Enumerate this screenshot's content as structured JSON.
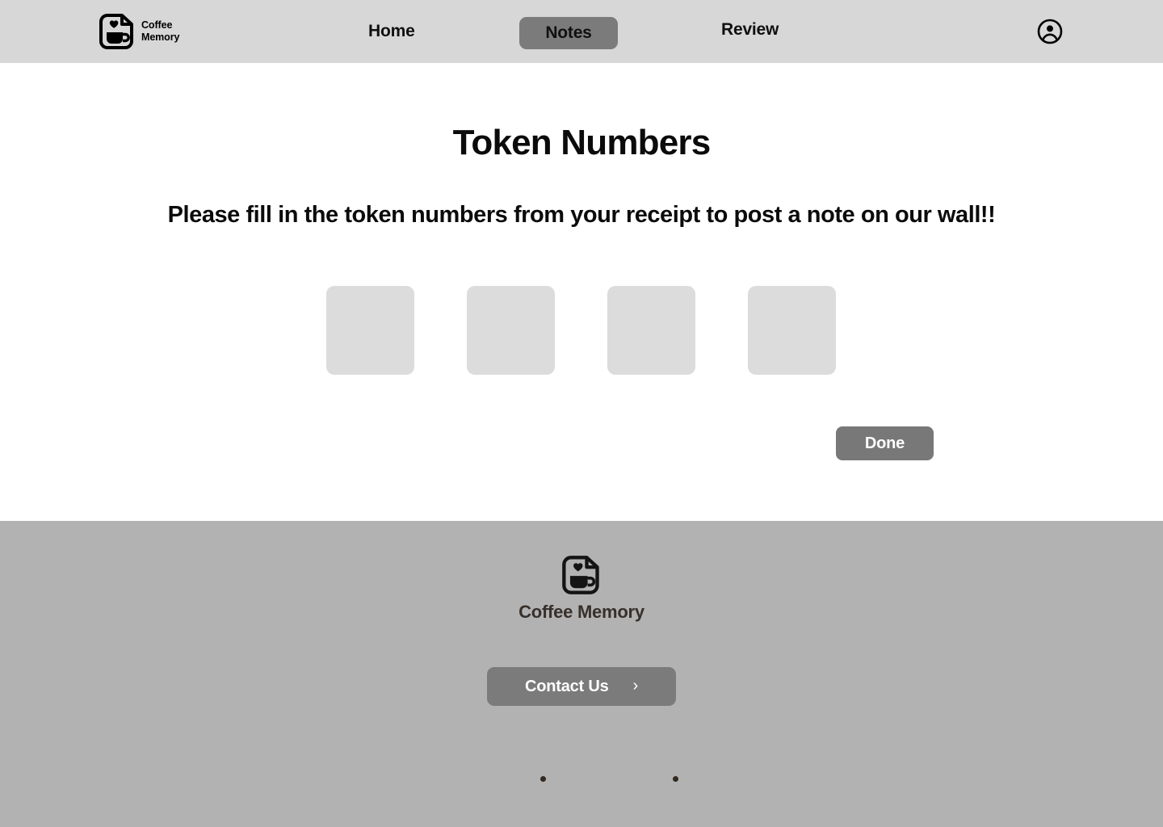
{
  "header": {
    "logo_icon": "coffee-note-logo-icon",
    "brand_line1": "Coffee",
    "brand_line2": "Memory",
    "nav": [
      {
        "label": "Home",
        "active": false
      },
      {
        "label": "Notes",
        "active": true
      },
      {
        "label": "Review",
        "active": false
      }
    ],
    "account_icon": "account-circle-icon",
    "background_color": "#d7d7d7",
    "active_tab_color": "#7b7b7b"
  },
  "main": {
    "title": "Token Numbers",
    "subtitle": "Please fill in the token numbers from your receipt to post a note on our wall!!",
    "token_inputs": [
      {
        "value": "",
        "placeholder": ""
      },
      {
        "value": "",
        "placeholder": ""
      },
      {
        "value": "",
        "placeholder": ""
      },
      {
        "value": "",
        "placeholder": ""
      }
    ],
    "done_label": "Done",
    "input_color": "#dcdcdc",
    "done_button_color": "#787878",
    "background_color": "#ffffff"
  },
  "footer": {
    "logo_icon": "coffee-note-logo-icon",
    "brand_name": "Coffee Memory",
    "contact_label": "Contact Us",
    "contact_chevron": "›",
    "social_dots": [
      {
        "icon": "social-dot-icon"
      },
      {
        "icon": "social-dot-icon"
      }
    ],
    "background_color": "#b2b2b2",
    "brand_text_color": "#37302b",
    "contact_button_color": "#7b7b7b"
  }
}
